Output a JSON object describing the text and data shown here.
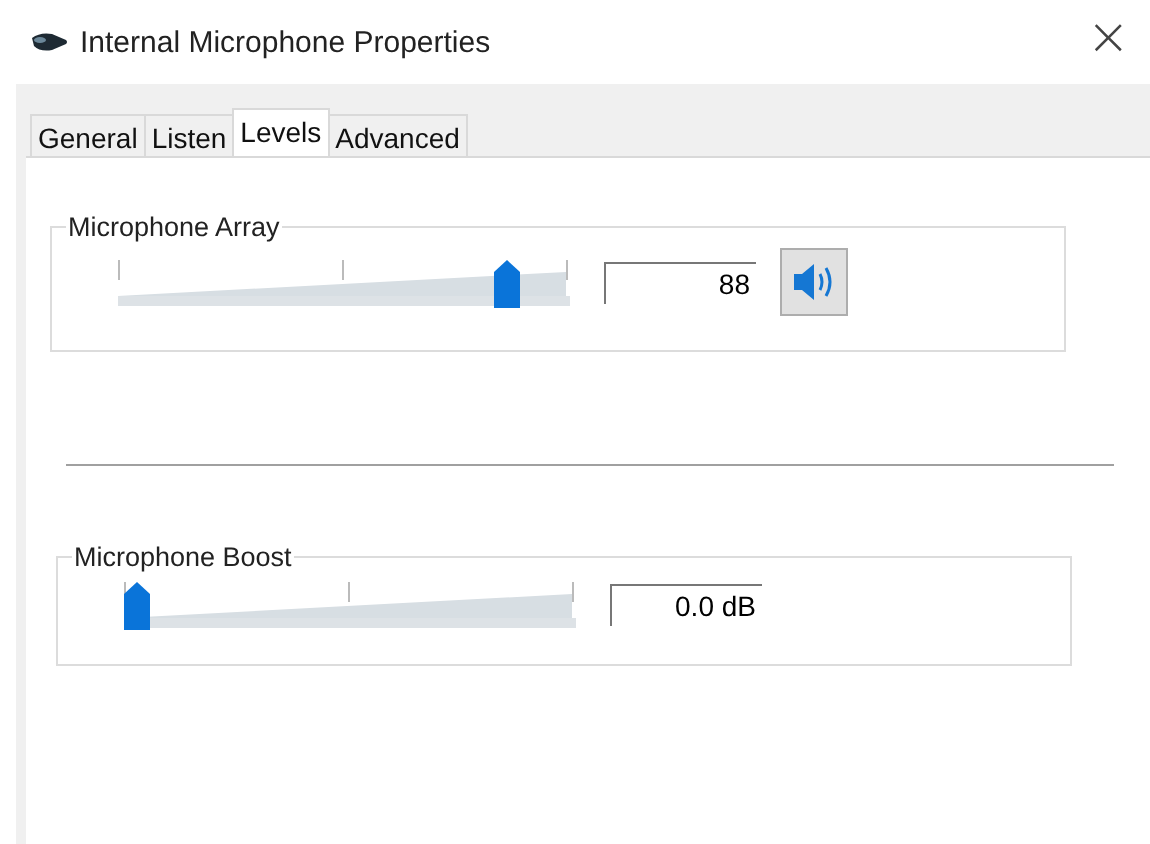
{
  "window": {
    "title": "Internal Microphone Properties",
    "close": "×"
  },
  "tabs": [
    {
      "label": "General",
      "selected": false
    },
    {
      "label": "Listen",
      "selected": false
    },
    {
      "label": "Levels",
      "selected": true
    },
    {
      "label": "Advanced",
      "selected": false
    }
  ],
  "levels": [
    {
      "name": "Microphone Array",
      "level": 0.88,
      "reading": "88",
      "kind": "mute",
      "muted": false
    },
    {
      "name": "Microphone Boost",
      "level": 0,
      "reading": "0.0 dB",
      "kind": "plain"
    }
  ]
}
